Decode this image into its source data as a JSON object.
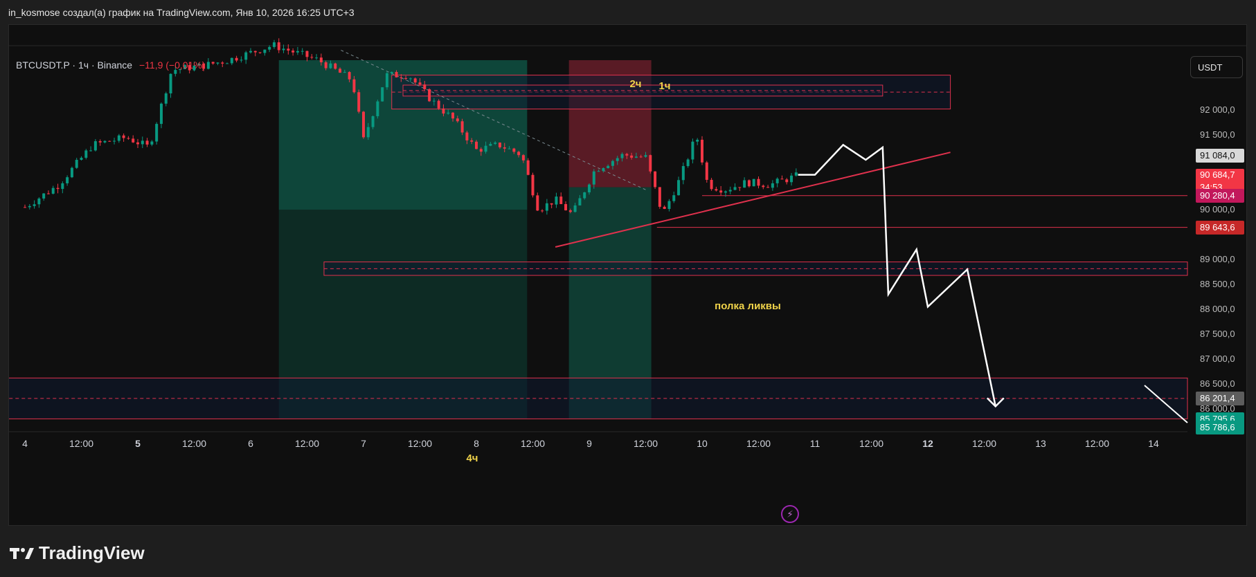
{
  "header": {
    "attribution": "in_kosmose создал(а) график на TradingView.com, Янв 10, 2026 16:25 UTC+3"
  },
  "symbol": {
    "name": "BTCUSDT.P · 1ч · Binance",
    "change": "−11,9 (−0,01%)"
  },
  "currency_button": "USDT",
  "price_axis": {
    "labels": [
      {
        "value": 92000,
        "text": "92 000,0"
      },
      {
        "value": 91500,
        "text": "91 500,0"
      },
      {
        "value": 90000,
        "text": "90 000,0"
      },
      {
        "value": 89000,
        "text": "89 000,0"
      },
      {
        "value": 88500,
        "text": "88 500,0"
      },
      {
        "value": 88000,
        "text": "88 000,0"
      },
      {
        "value": 87500,
        "text": "87 500,0"
      },
      {
        "value": 87000,
        "text": "87 000,0"
      },
      {
        "value": 86500,
        "text": "86 500,0"
      },
      {
        "value": 86000,
        "text": "86 000,0"
      }
    ],
    "tags": [
      {
        "value": 91084.0,
        "text": "91 084,0",
        "color": "#d9d9d9",
        "text_color": "#111111"
      },
      {
        "value": 90684.7,
        "text": "90 684,7",
        "sub": "34:53",
        "color": "#f23645",
        "text_color": "#ffffff"
      },
      {
        "value": 90280.4,
        "text": "90 280,4",
        "color": "#c2185b",
        "text_color": "#ffffff"
      },
      {
        "value": 89643.6,
        "text": "89 643,6",
        "color": "#c62828",
        "text_color": "#ffffff"
      },
      {
        "value": 86201.4,
        "text": "86 201,4",
        "color": "#5d5d5d",
        "text_color": "#ffffff"
      },
      {
        "value": 85795.6,
        "text": "85 795,6",
        "color": "#089981",
        "text_color": "#ffffff"
      },
      {
        "value": 85786.6,
        "text": "85 786,6",
        "color": "#089981",
        "text_color": "#ffffff"
      }
    ]
  },
  "time_axis": [
    {
      "text": "4",
      "bold": false
    },
    {
      "text": "12:00",
      "bold": false
    },
    {
      "text": "5",
      "bold": true
    },
    {
      "text": "12:00",
      "bold": false
    },
    {
      "text": "6",
      "bold": false
    },
    {
      "text": "12:00",
      "bold": false
    },
    {
      "text": "7",
      "bold": false
    },
    {
      "text": "12:00",
      "bold": false
    },
    {
      "text": "8",
      "bold": false
    },
    {
      "text": "12:00",
      "bold": false
    },
    {
      "text": "9",
      "bold": false
    },
    {
      "text": "12:00",
      "bold": false
    },
    {
      "text": "10",
      "bold": false
    },
    {
      "text": "12:00",
      "bold": false
    },
    {
      "text": "11",
      "bold": false
    },
    {
      "text": "12:00",
      "bold": false
    },
    {
      "text": "12",
      "bold": true
    },
    {
      "text": "12:00",
      "bold": false
    },
    {
      "text": "13",
      "bold": false
    },
    {
      "text": "12:00",
      "bold": false
    },
    {
      "text": "14",
      "bold": false
    }
  ],
  "annotations": {
    "zone_2h": "2ч",
    "zone_1h": "1ч",
    "liq_shelf": "полка ликвы",
    "zone_4h": "4ч"
  },
  "logo": "TradingView",
  "colors": {
    "up": "#089981",
    "down": "#f23645",
    "zone_border": "#e0314d",
    "annotation_text": "#f0d34a",
    "projection": "#ffffff"
  },
  "chart_data": {
    "type": "candlestick",
    "symbol": "BTCUSDT.P",
    "interval": "1ч",
    "exchange": "Binance",
    "x_start": "4 Jan 2026 00:00",
    "x_end": "14 Jan 2026",
    "y_range": [
      85700,
      92700
    ],
    "path_anchors": [
      [
        4.0,
        90050
      ],
      [
        4.3,
        90500
      ],
      [
        4.6,
        91300
      ],
      [
        4.9,
        91450
      ],
      [
        5.1,
        91250
      ],
      [
        5.3,
        92800
      ],
      [
        5.6,
        92900
      ],
      [
        5.8,
        93000
      ],
      [
        6.2,
        93300
      ],
      [
        6.6,
        93000
      ],
      [
        6.9,
        92600
      ],
      [
        7.0,
        91400
      ],
      [
        7.2,
        92700
      ],
      [
        7.4,
        92700
      ],
      [
        7.6,
        92200
      ],
      [
        7.8,
        91800
      ],
      [
        8.0,
        91200
      ],
      [
        8.2,
        91300
      ],
      [
        8.4,
        91100
      ],
      [
        8.55,
        90000
      ],
      [
        8.7,
        90200
      ],
      [
        8.85,
        89900
      ],
      [
        9.05,
        90800
      ],
      [
        9.3,
        91100
      ],
      [
        9.5,
        91050
      ],
      [
        9.65,
        89900
      ],
      [
        9.8,
        90600
      ],
      [
        9.95,
        91500
      ],
      [
        10.05,
        90500
      ],
      [
        10.2,
        90400
      ],
      [
        10.4,
        90550
      ],
      [
        10.6,
        90500
      ],
      [
        10.85,
        90684.7
      ]
    ],
    "projection_path": [
      [
        10.85,
        90700
      ],
      [
        11.0,
        90700
      ],
      [
        11.25,
        91300
      ],
      [
        11.45,
        91000
      ],
      [
        11.6,
        91250
      ],
      [
        11.65,
        88300
      ],
      [
        11.9,
        89200
      ],
      [
        12.0,
        88050
      ],
      [
        12.35,
        88800
      ],
      [
        12.6,
        86050
      ]
    ],
    "levels": [
      {
        "price": 90280.4,
        "from_day": 10.0
      },
      {
        "price": 89643.6,
        "from_day": 9.6
      }
    ],
    "trendline": [
      [
        8.7,
        89250
      ],
      [
        12.2,
        91150
      ]
    ],
    "zones": [
      {
        "label": "2ч",
        "top": 92700,
        "bottom": 92020,
        "from_day": 7.25,
        "to_day": 12.2
      },
      {
        "label": "1ч",
        "top": 92500,
        "bottom": 92280,
        "from_day": 7.35,
        "to_day": 11.6
      },
      {
        "label": "полка ликвы",
        "top": 88950,
        "bottom": 88680,
        "from_day": 6.65,
        "to_day": 14.5
      },
      {
        "label": "4ч",
        "top": 86620,
        "bottom": 85800,
        "from_day": 3.75,
        "to_day": 14.5
      }
    ],
    "position_boxes": [
      {
        "from_day": 6.25,
        "to_day": 8.45,
        "entry": 90000,
        "target": 93000,
        "stop": 85800
      },
      {
        "from_day": 8.82,
        "to_day": 9.55,
        "entry": 90450,
        "target": 85800,
        "stop": 93000
      }
    ]
  }
}
